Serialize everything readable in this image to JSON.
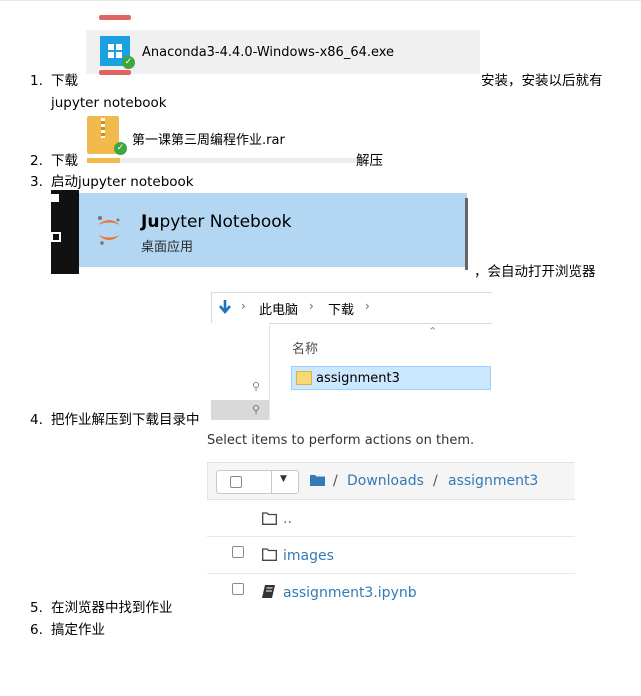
{
  "steps": [
    {
      "num": "1.",
      "before": "下载",
      "after": "安装，安装以后就有",
      "cont": "jupyter notebook"
    },
    {
      "num": "2.",
      "before": "下载",
      "after": "解压"
    },
    {
      "num": "3.",
      "before": "启动jupyter notebook",
      "after": "，会自动打开浏览器"
    },
    {
      "num": "4.",
      "before": "把作业解压到下载目录中"
    },
    {
      "num": "5.",
      "before": "在浏览器中找到作业"
    },
    {
      "num": "6.",
      "before": "搞定作业"
    }
  ],
  "anaconda_file": {
    "name": "Anaconda3-4.4.0-Windows-x86_64.exe"
  },
  "rar_file": {
    "name": "第一课第三周编程作业.rar"
  },
  "jupyter_tile": {
    "title_bold": "Ju",
    "title_rest": "pyter Notebook",
    "subtitle": "桌面应用"
  },
  "explorer": {
    "breadcrumb": [
      "此电脑",
      "下载"
    ],
    "column_header": "名称",
    "item": "assignment3"
  },
  "jupyter_browser": {
    "hint": "Select items to perform actions on them.",
    "path": [
      "Downloads",
      "assignment3"
    ],
    "separator": "/",
    "rows": [
      {
        "name": ".."
      },
      {
        "name": "images"
      },
      {
        "name": "assignment3.ipynb"
      }
    ]
  },
  "colors": {
    "accent_link": "#337ab7",
    "tile_bg": "#b3d7f2",
    "explorer_sel": "#cce8ff"
  }
}
